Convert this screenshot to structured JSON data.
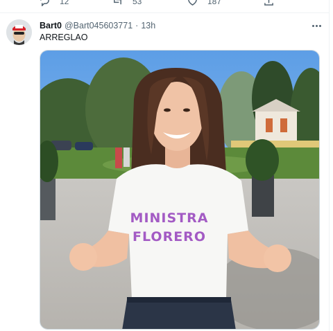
{
  "previous_tweet": {
    "replies": "12",
    "retweets": "53",
    "likes": "187"
  },
  "tweet": {
    "display_name": "Bart0",
    "handle": "@Bart045603771",
    "separator": "·",
    "time": "13h",
    "text": "ARREGLAO"
  },
  "media": {
    "shirt_line1": "MINISTRA",
    "shirt_line2": "FLORERO",
    "shirt_text_color": "#a35bc4"
  },
  "icons": {
    "reply": "reply-icon",
    "retweet": "retweet-icon",
    "like": "heart-icon",
    "share": "share-icon",
    "more": "more-options-icon"
  }
}
